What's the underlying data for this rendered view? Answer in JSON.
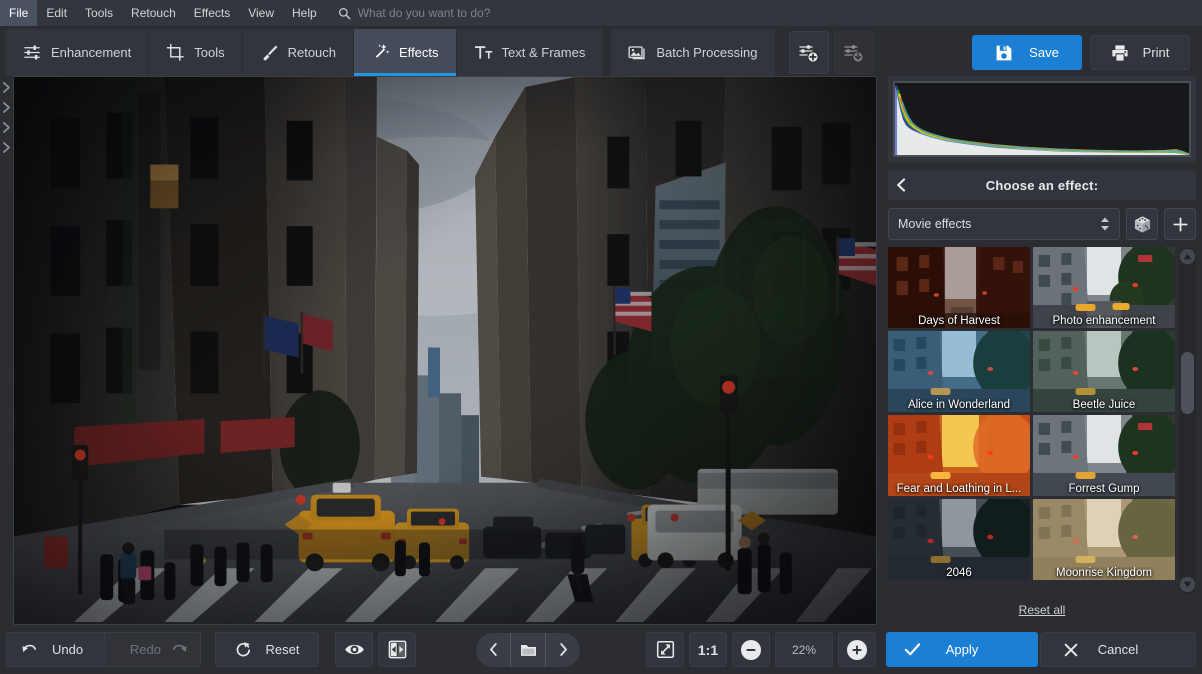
{
  "app": {
    "accent": "#1b7fd4",
    "panel_bg": "#2b2d33",
    "tab_bg": "#33353c",
    "active_tab_bg": "#454b58"
  },
  "menubar": {
    "items": [
      {
        "label": "File",
        "active": true
      },
      {
        "label": "Edit",
        "active": false
      },
      {
        "label": "Tools",
        "active": false
      },
      {
        "label": "Retouch",
        "active": false
      },
      {
        "label": "Effects",
        "active": false
      },
      {
        "label": "View",
        "active": false
      },
      {
        "label": "Help",
        "active": false
      }
    ],
    "search_icon": "search-icon",
    "search_placeholder": "What do you want to do?"
  },
  "toolbar": {
    "tabs": [
      {
        "label": "Enhancement",
        "icon": "sliders-icon",
        "active": false
      },
      {
        "label": "Tools",
        "icon": "crop-icon",
        "active": false
      },
      {
        "label": "Retouch",
        "icon": "brush-icon",
        "active": false
      },
      {
        "label": "Effects",
        "icon": "magic-wand-icon",
        "active": true
      },
      {
        "label": "Text & Frames",
        "icon": "text-icon",
        "active": false
      },
      {
        "label": "Batch Processing",
        "icon": "images-icon",
        "active": false
      }
    ],
    "preset_save_icon": "preset-add-icon",
    "preset_load_icon": "preset-load-icon",
    "save_label": "Save",
    "save_icon": "floppy-disk-icon",
    "print_label": "Print",
    "print_icon": "printer-icon"
  },
  "rail": {
    "arrows": [
      "chevron-right-icon",
      "chevron-right-icon",
      "chevron-right-icon",
      "chevron-right-icon"
    ]
  },
  "canvas": {
    "name": "image-canvas",
    "description": "New York City street scene with yellow taxis, crosswalk and tall buildings"
  },
  "right_panel": {
    "histogram_name": "histogram",
    "back_icon": "chevron-left-icon",
    "title": "Choose an effect:",
    "category": {
      "value": "Movie effects",
      "spinner_icon": "spinner-updown-icon"
    },
    "random_icon": "dice-icon",
    "add_icon": "plus-icon",
    "effects": [
      {
        "label": "Days of Harvest",
        "tone": "harvest"
      },
      {
        "label": "Photo enhancement",
        "tone": "enhance"
      },
      {
        "label": "Alice in Wonderland",
        "tone": "alice"
      },
      {
        "label": "Beetle Juice",
        "tone": "beetle"
      },
      {
        "label": "Fear and Loathing in L...",
        "tone": "fear"
      },
      {
        "label": "Forrest Gump",
        "tone": "forrest"
      },
      {
        "label": "2046",
        "tone": "n2046"
      },
      {
        "label": "Moonrise Kingdom",
        "tone": "moonrise"
      }
    ],
    "scrollbar": {
      "up_icon": "triangle-up-icon",
      "down_icon": "triangle-down-icon"
    },
    "reset_all_label": "Reset all"
  },
  "bottombar": {
    "undo_label": "Undo",
    "undo_icon": "undo-arrow-icon",
    "redo_label": "Redo",
    "redo_icon": "redo-arrow-icon",
    "redo_disabled": true,
    "reset_label": "Reset",
    "reset_icon": "reset-circle-icon",
    "preview_icon": "eye-icon",
    "compare_icon": "split-compare-icon",
    "prev_icon": "chevron-left-icon",
    "open_folder_icon": "folder-icon",
    "next_icon": "chevron-right-icon",
    "fit_icon": "fit-to-screen-icon",
    "one_to_one_label": "1:1",
    "zoom_out_icon": "minus-circle-icon",
    "zoom_level": "22%",
    "zoom_in_icon": "plus-circle-icon",
    "apply_label": "Apply",
    "apply_icon": "check-icon",
    "cancel_label": "Cancel",
    "cancel_icon": "close-x-icon"
  }
}
